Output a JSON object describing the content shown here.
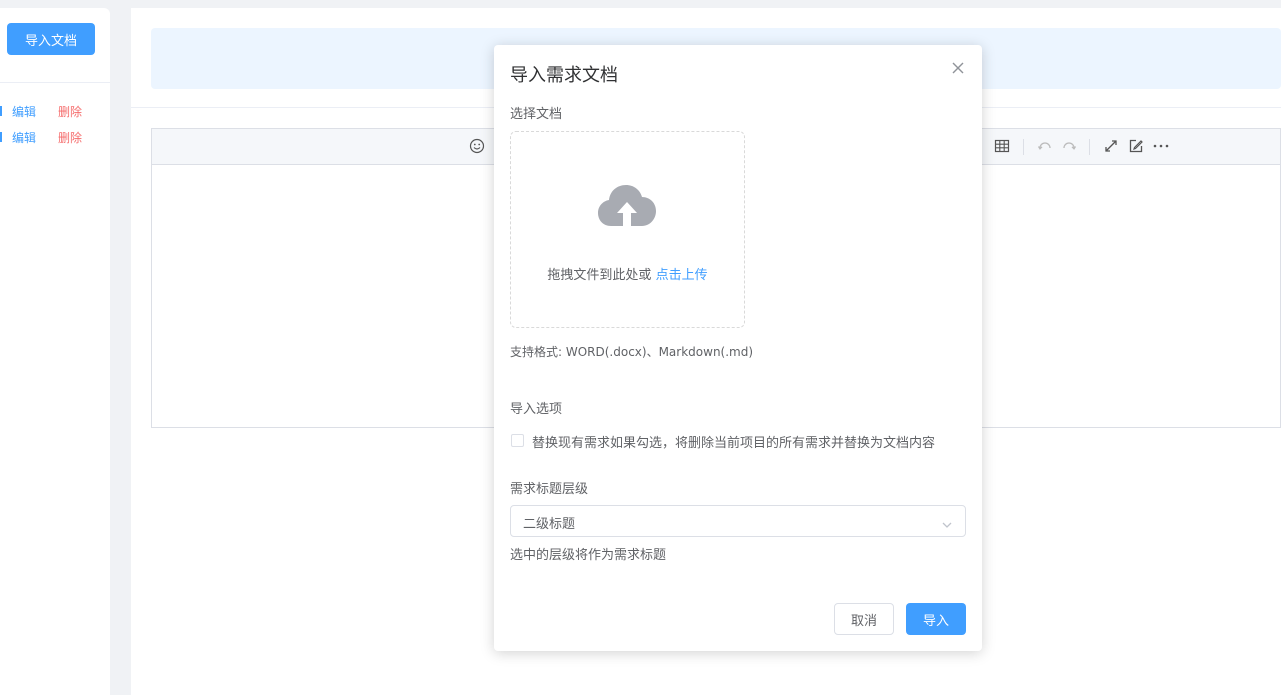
{
  "left_panel": {
    "import_button_label": "导入文档",
    "rows": [
      {
        "edit_label": "编辑",
        "delete_label": "删除"
      },
      {
        "edit_label": "编辑",
        "delete_label": "删除"
      }
    ]
  },
  "editor": {
    "toolbar_icons": [
      "emoji-icon",
      "table-icon",
      "undo-icon",
      "redo-icon",
      "fullscreen-icon",
      "edit-icon",
      "more-icon"
    ]
  },
  "dialog": {
    "title": "导入需求文档",
    "select_doc_label": "选择文档",
    "upload_text": "拖拽文件到此处或",
    "upload_link": "点击上传",
    "support_text": "支持格式: WORD(.docx)、Markdown(.md)",
    "options_label": "导入选项",
    "replace_checkbox_label": "替换现有需求如果勾选，将删除当前项目的所有需求并替换为文档内容",
    "level_label": "需求标题层级",
    "level_value": "二级标题",
    "level_hint": "选中的层级将作为需求标题",
    "cancel_label": "取消",
    "import_label": "导入"
  },
  "colors": {
    "primary": "#409eff",
    "danger": "#f56c6c",
    "text": "#606266",
    "title": "#303133"
  }
}
